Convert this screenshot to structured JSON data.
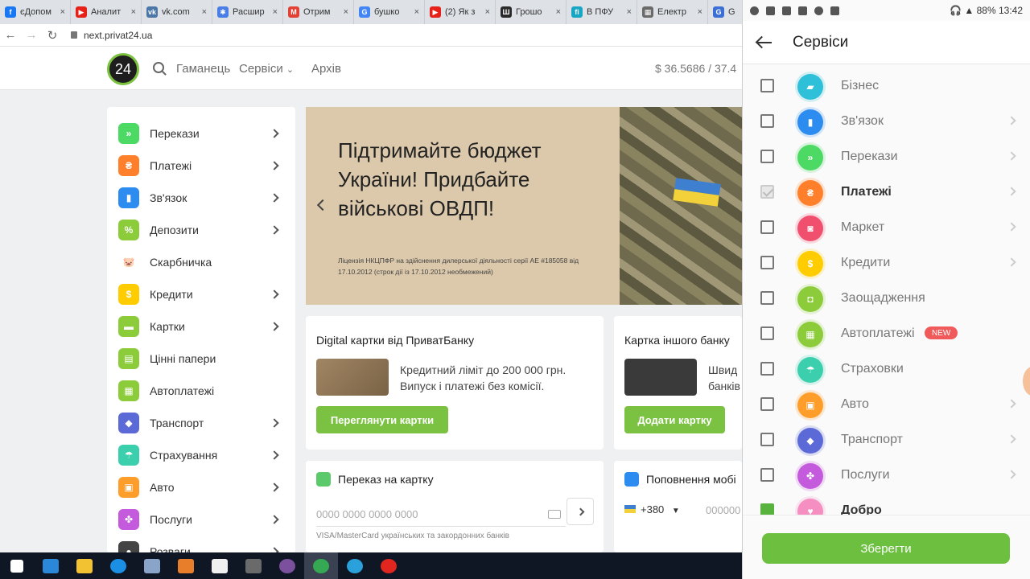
{
  "browser": {
    "tabs": [
      {
        "label": "єДопом",
        "color": "#1877f2",
        "glyph": "f"
      },
      {
        "label": "Аналит",
        "color": "#e62117",
        "glyph": "▶"
      },
      {
        "label": "vk.com",
        "color": "#4a76a8",
        "glyph": "vk"
      },
      {
        "label": "Расшир",
        "color": "#4a7ee6",
        "glyph": "✱"
      },
      {
        "label": "Отрим",
        "color": "#e34133",
        "glyph": "M"
      },
      {
        "label": "бушко",
        "color": "#4285f4",
        "glyph": "G"
      },
      {
        "label": "(2) Як з",
        "color": "#e62117",
        "glyph": "▶"
      },
      {
        "label": "Грошо",
        "color": "#2a2a2a",
        "glyph": "Ш"
      },
      {
        "label": "В ПФУ",
        "color": "#17a6c4",
        "glyph": "fi"
      },
      {
        "label": "Електр",
        "color": "#6a6a6a",
        "glyph": "▦"
      },
      {
        "label": "G",
        "color": "#3b6fd6",
        "glyph": "G"
      }
    ],
    "url": "next.privat24.ua"
  },
  "header": {
    "logo": "24",
    "nav": [
      "Гаманець",
      "Сервіси",
      "Архів"
    ],
    "rate": "$  36.5686 / 37.4"
  },
  "menu": [
    {
      "label": "Перекази",
      "color": "#4cd964",
      "glyph": "»",
      "chevron": true
    },
    {
      "label": "Платежі",
      "color": "#ff7f2a",
      "glyph": "₴",
      "chevron": true
    },
    {
      "label": "Зв'язок",
      "color": "#2d8cf0",
      "glyph": "▮",
      "chevron": true
    },
    {
      "label": "Депозити",
      "color": "#8ccc3a",
      "glyph": "%",
      "chevron": true
    },
    {
      "label": "Скарбничка",
      "color": "#ffffff",
      "glyph": "🐷",
      "chevron": false
    },
    {
      "label": "Кредити",
      "color": "#ffcc00",
      "glyph": "$",
      "chevron": true
    },
    {
      "label": "Картки",
      "color": "#8ccc3a",
      "glyph": "▬",
      "chevron": true
    },
    {
      "label": "Цінні папери",
      "color": "#8ccc3a",
      "glyph": "▤",
      "chevron": false
    },
    {
      "label": "Автоплатежі",
      "color": "#8ccc3a",
      "glyph": "▦",
      "chevron": false
    },
    {
      "label": "Транспорт",
      "color": "#5b6ad6",
      "glyph": "◆",
      "chevron": true
    },
    {
      "label": "Страхування",
      "color": "#3ccfae",
      "glyph": "☂",
      "chevron": true
    },
    {
      "label": "Авто",
      "color": "#ff9d2a",
      "glyph": "▣",
      "chevron": true
    },
    {
      "label": "Послуги",
      "color": "#c35bdc",
      "glyph": "✤",
      "chevron": true
    },
    {
      "label": "Розваги",
      "color": "#444444",
      "glyph": "●",
      "chevron": true
    }
  ],
  "banner": {
    "title": "Підтримайте бюджет України! Придбайте військові ОВДП!",
    "license": "Ліцензія НКЦПФР на здійснення дилерської діяльності серії АЕ #185058 від 17.10.2012 (строк дії із 17.10.2012 необмежений)"
  },
  "cards": {
    "digital": {
      "title": "Digital картки від ПриватБанку",
      "text1": "Кредитний ліміт до 200 000 грн.",
      "text2": "Випуск і платежі без комісії.",
      "button": "Переглянути картки"
    },
    "other": {
      "title": "Картка іншого банку",
      "text1": "Швид",
      "text2": "банків",
      "button": "Додати картку"
    },
    "transfer": {
      "title": "Переказ на картку",
      "placeholder": "0000 0000 0000 0000",
      "hint": "VISA/MasterCard українських та закордонних банків"
    },
    "mobile": {
      "title": "Поповнення мобі",
      "code": "+380",
      "placeholder": "000000"
    }
  },
  "phone": {
    "time": "13:42",
    "battery": "88%",
    "title": "Сервіси",
    "items": [
      {
        "label": "Бізнес",
        "color": "#2ebfd9",
        "glyph": "▰",
        "state": "empty",
        "chevron": false,
        "bold": false
      },
      {
        "label": "Зв'язок",
        "color": "#2d8cf0",
        "glyph": "▮",
        "state": "empty",
        "chevron": true,
        "bold": false
      },
      {
        "label": "Перекази",
        "color": "#4cd964",
        "glyph": "»",
        "state": "empty",
        "chevron": true,
        "bold": false
      },
      {
        "label": "Платежі",
        "color": "#ff7f2a",
        "glyph": "₴",
        "state": "checked",
        "chevron": true,
        "bold": true
      },
      {
        "label": "Маркет",
        "color": "#f0506e",
        "glyph": "◙",
        "state": "empty",
        "chevron": true,
        "bold": false
      },
      {
        "label": "Кредити",
        "color": "#ffcc00",
        "glyph": "$",
        "state": "empty",
        "chevron": true,
        "bold": false
      },
      {
        "label": "Заощадження",
        "color": "#8ccc3a",
        "glyph": "◘",
        "state": "empty",
        "chevron": false,
        "bold": false
      },
      {
        "label": "Автоплатежі",
        "color": "#8ccc3a",
        "glyph": "▦",
        "state": "empty",
        "chevron": false,
        "bold": false,
        "badge": "NEW"
      },
      {
        "label": "Страховки",
        "color": "#3ccfae",
        "glyph": "☂",
        "state": "empty",
        "chevron": false,
        "bold": false
      },
      {
        "label": "Авто",
        "color": "#ff9d2a",
        "glyph": "▣",
        "state": "empty",
        "chevron": true,
        "bold": false
      },
      {
        "label": "Транспорт",
        "color": "#5b6ad6",
        "glyph": "◆",
        "state": "empty",
        "chevron": true,
        "bold": false
      },
      {
        "label": "Послуги",
        "color": "#c35bdc",
        "glyph": "✤",
        "state": "empty",
        "chevron": true,
        "bold": false
      },
      {
        "label": "Добро",
        "color": "#f58fc2",
        "glyph": "♥",
        "state": "green",
        "chevron": false,
        "bold": true
      }
    ],
    "save": "Зберегти"
  },
  "taskbar": [
    {
      "name": "windows-start-icon",
      "color": "#ffffff"
    },
    {
      "name": "mail-icon",
      "color": "#2b88d8"
    },
    {
      "name": "folder-icon",
      "color": "#f2c233"
    },
    {
      "name": "edge-icon",
      "color": "#1a8fe3"
    },
    {
      "name": "network-tool-icon",
      "color": "#8aa3c8"
    },
    {
      "name": "pen-icon",
      "color": "#e87d2a"
    },
    {
      "name": "store-icon",
      "color": "#f0f0f0"
    },
    {
      "name": "calculator-icon",
      "color": "#6a6a6a"
    },
    {
      "name": "viber-icon",
      "color": "#7b519d"
    },
    {
      "name": "chrome-icon",
      "color": "#34a853"
    },
    {
      "name": "telegram-icon",
      "color": "#2aa1da"
    },
    {
      "name": "recorder-icon",
      "color": "#e0261f"
    }
  ]
}
